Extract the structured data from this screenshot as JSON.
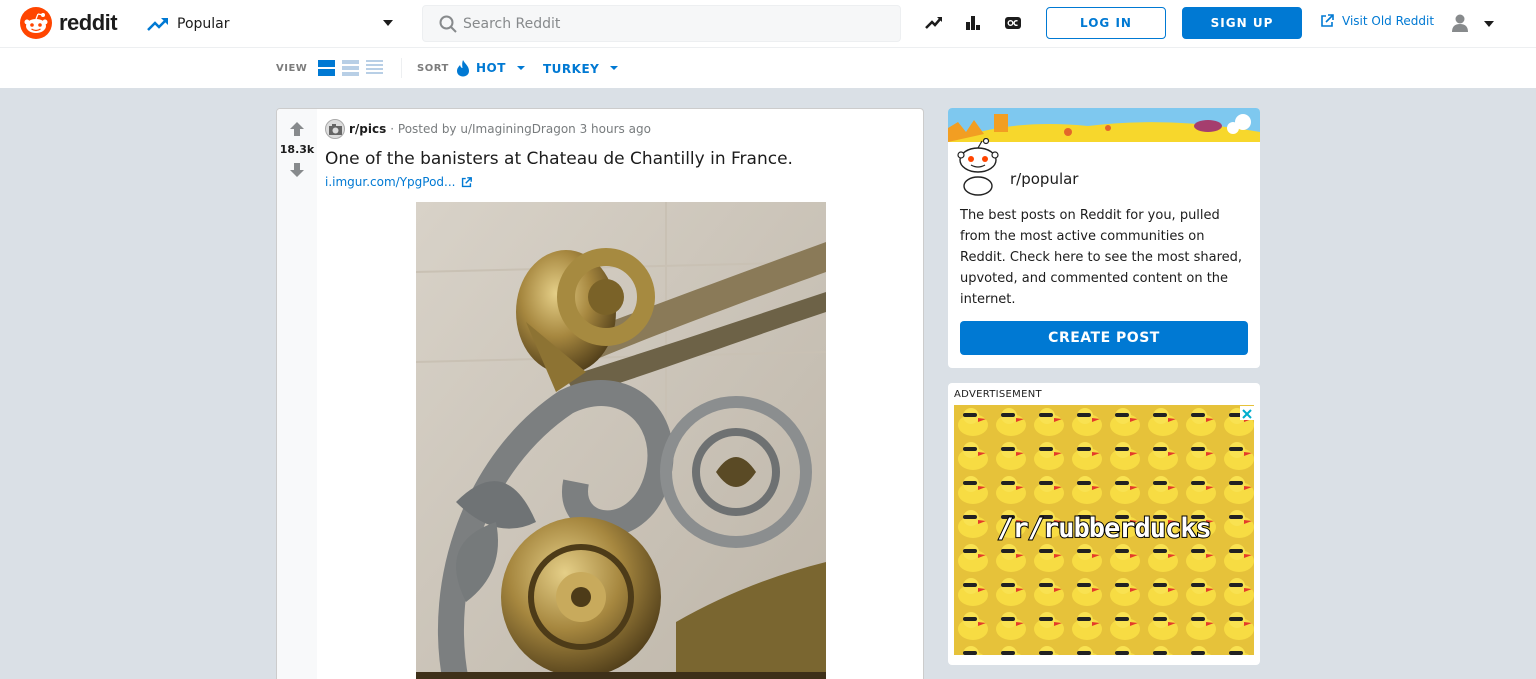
{
  "header": {
    "logo_text": "reddit",
    "feed_label": "Popular",
    "search_placeholder": "Search Reddit",
    "login_label": "LOG IN",
    "signup_label": "SIGN UP",
    "old_reddit_label": "Visit Old Reddit",
    "brand_color": "#ff4500",
    "accent_color": "#0079d3"
  },
  "subheader": {
    "view_label": "VIEW",
    "sort_label": "SORT",
    "sort_value": "HOT",
    "geo_value": "TURKEY"
  },
  "post": {
    "score": "18.3k",
    "subreddit": "r/pics",
    "meta": "· Posted by u/ImaginingDragon 3 hours ago",
    "title": "One of the banisters at Chateau de Chantilly in France.",
    "link_text": "i.imgur.com/YpgPod..."
  },
  "sidebar": {
    "card_title": "r/popular",
    "card_description": "The best posts on Reddit for you, pulled from the most active communities on Reddit. Check here to see the most shared, upvoted, and commented content on the internet.",
    "create_post_label": "CREATE POST",
    "ad_label": "ADVERTISEMENT",
    "ad_text": "/r/rubberducks"
  }
}
